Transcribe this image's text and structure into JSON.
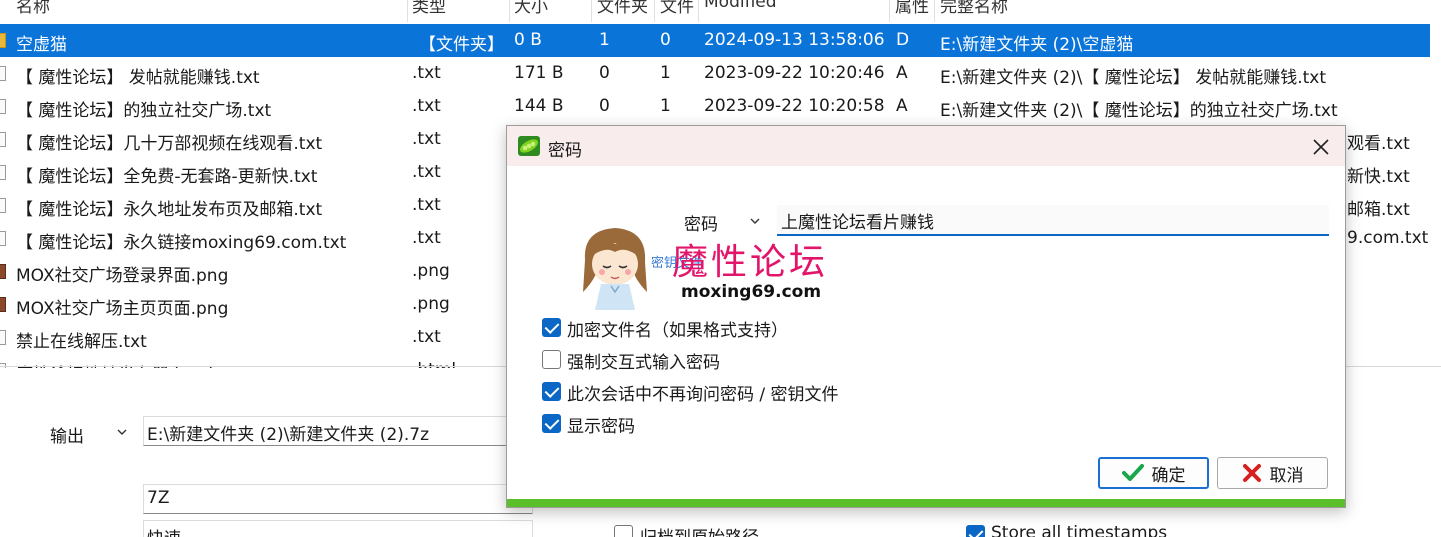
{
  "file_list": {
    "headers": [
      "名称",
      "类型",
      "大小",
      "文件夹",
      "文件",
      "Modified",
      "属性",
      "完整名称"
    ],
    "rows": [
      {
        "name": "空虚猫",
        "type": "【文件夹】",
        "size": "0 B",
        "folders": "1",
        "files": "0",
        "modified": "2024-09-13 13:58:06",
        "attr": "D",
        "full": "E:\\新建文件夹 (2)\\空虚猫",
        "icon": "folder-icon",
        "selected": true
      },
      {
        "name": "【 魔性论坛】 发帖就能赚钱.txt",
        "type": ".txt",
        "size": "171 B",
        "folders": "0",
        "files": "1",
        "modified": "2023-09-22 10:20:46",
        "attr": "A",
        "full": "E:\\新建文件夹 (2)\\【 魔性论坛】 发帖就能赚钱.txt",
        "icon": "text-file-icon",
        "selected": false
      },
      {
        "name": "【 魔性论坛】的独立社交广场.txt",
        "type": ".txt",
        "size": "144 B",
        "folders": "0",
        "files": "1",
        "modified": "2023-09-22 10:20:58",
        "attr": "A",
        "full": "E:\\新建文件夹 (2)\\【 魔性论坛】的独立社交广场.txt",
        "icon": "text-file-icon",
        "selected": false
      },
      {
        "name": "【 魔性论坛】几十万部视频在线观看.txt",
        "type": ".txt",
        "full": "观看.txt",
        "icon": "text-file-icon"
      },
      {
        "name": "【 魔性论坛】全免费-无套路-更新快.txt",
        "type": ".txt",
        "full": "新快.txt",
        "icon": "text-file-icon"
      },
      {
        "name": "【 魔性论坛】永久地址发布页及邮箱.txt",
        "type": ".txt",
        "full": "邮箱.txt",
        "icon": "text-file-icon"
      },
      {
        "name": "【 魔性论坛】永久链接moxing69.com.txt",
        "type": ".txt",
        "full": "9.com.txt",
        "icon": "text-file-icon"
      },
      {
        "name": "MOX社交广场登录界面.png",
        "type": ".png",
        "icon": "image-file-icon"
      },
      {
        "name": "MOX社交广场主页页面.png",
        "type": ".png",
        "icon": "image-file-icon"
      },
      {
        "name": "禁止在线解压.txt",
        "type": ".txt",
        "icon": "text-file-icon"
      },
      {
        "name": "魔性论坛地址发布器.html",
        "type": ".html",
        "icon": "html-file-icon"
      }
    ]
  },
  "output": {
    "label": "输出",
    "path": "E:\\新建文件夹 (2)\\新建文件夹 (2).7z",
    "format": "7Z",
    "method": "快速",
    "archive_original_path": "归档到原始路径",
    "store_timestamps": "Store all timestamps"
  },
  "dialog": {
    "title": "密码",
    "mode_label": "密码",
    "password_value": "上魔性论坛看片赚钱",
    "keyfile_link": "密钥文件",
    "watermark": {
      "title": "魔性论坛",
      "url": "moxing69.com"
    },
    "options": [
      {
        "label": "加密文件名（如果格式支持）",
        "checked": true
      },
      {
        "label": "强制交互式输入密码",
        "checked": false
      },
      {
        "label": "此次会话中不再询问密码 / 密钥文件",
        "checked": true
      },
      {
        "label": "显示密码",
        "checked": true
      }
    ],
    "ok_label": "确定",
    "cancel_label": "取消"
  },
  "colors": {
    "selection": "#0a74d9",
    "accent_green": "#5bbf2a",
    "checkbox": "#0a67c5",
    "ok_icon": "#1aa64a",
    "cancel_icon": "#d62020"
  }
}
